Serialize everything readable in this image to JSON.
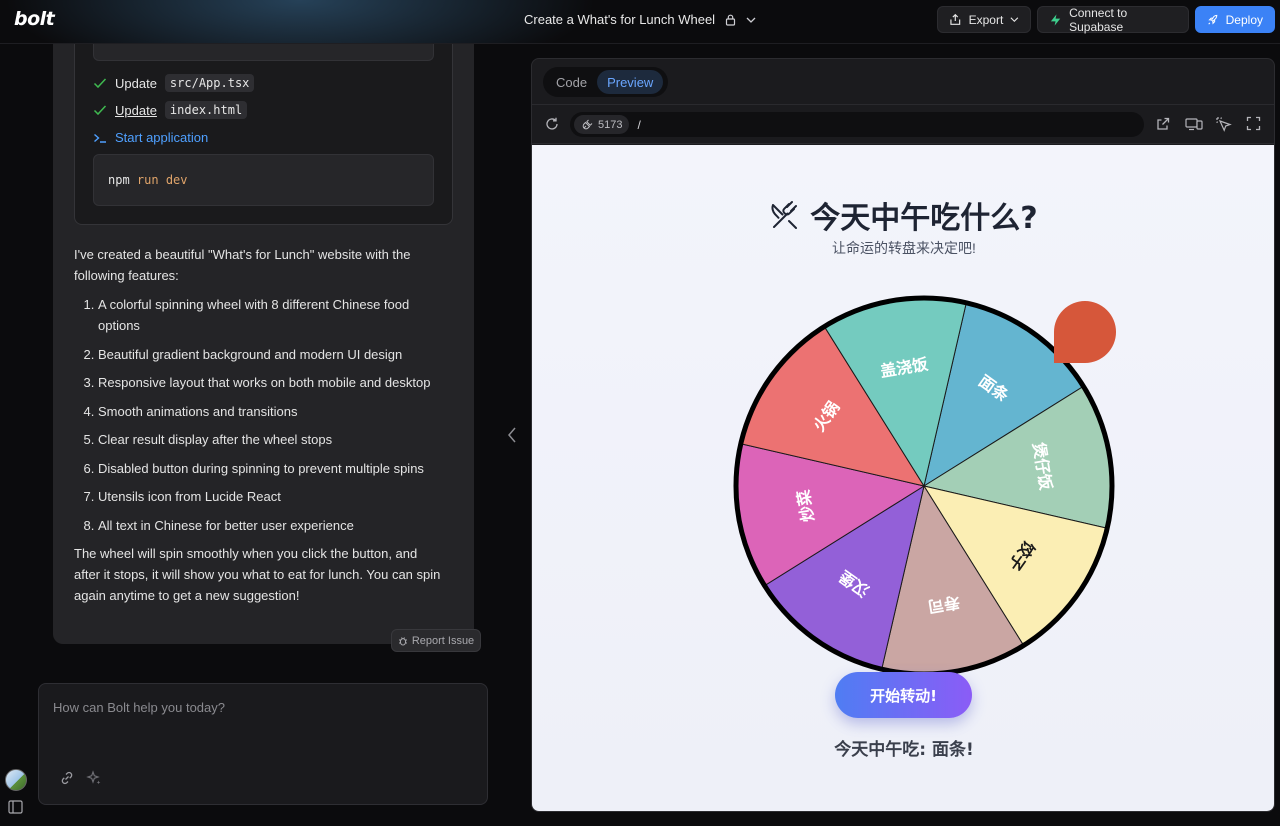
{
  "header": {
    "logo": "bolt",
    "project_title": "Create a What's for Lunch Wheel",
    "export_label": "Export",
    "supabase_label": "Connect to Supabase",
    "deploy_label": "Deploy"
  },
  "chat": {
    "actions": [
      {
        "verb": "Update",
        "file": "src/App.tsx"
      },
      {
        "verb": "Update",
        "file": "index.html"
      }
    ],
    "start_label": "Start application",
    "command": {
      "cmd": "npm",
      "args": "run dev"
    },
    "intro": "I've created a beautiful \"What's for Lunch\" website with the following features:",
    "features": [
      "A colorful spinning wheel with 8 different Chinese food options",
      "Beautiful gradient background and modern UI design",
      "Responsive layout that works on both mobile and desktop",
      "Smooth animations and transitions",
      "Clear result display after the wheel stops",
      "Disabled button during spinning to prevent multiple spins",
      "Utensils icon from Lucide React",
      "All text in Chinese for better user experience"
    ],
    "outro": "The wheel will spin smoothly when you click the button, and after it stops, it will show you what to eat for lunch. You can spin again anytime to get a new suggestion!",
    "report_label": "Report Issue"
  },
  "prompt": {
    "placeholder": "How can Bolt help you today?"
  },
  "preview": {
    "tabs": [
      {
        "label": "Code",
        "active": false
      },
      {
        "label": "Preview",
        "active": true
      }
    ],
    "port": "5173",
    "path": "/"
  },
  "app": {
    "title": "今天中午吃什么?",
    "subtitle": "让命运的转盘来决定吧!",
    "spin_label": "开始转动!",
    "result": "今天中午吃: 面条!",
    "wheel": {
      "segments": [
        {
          "label": "面条",
          "color": "#64b5d0"
        },
        {
          "label": "煲仔饭",
          "color": "#a3cfb6"
        },
        {
          "label": "饺子",
          "color": "#fbeeb4"
        },
        {
          "label": "寿司",
          "color": "#caa6a3"
        },
        {
          "label": "汉堡",
          "color": "#9360d8"
        },
        {
          "label": "炒菜",
          "color": "#dc64b8"
        },
        {
          "label": "火锅",
          "color": "#ec7272"
        },
        {
          "label": "盖浇饭",
          "color": "#74cbbf"
        }
      ],
      "pointer_color": "#d6573a"
    }
  }
}
